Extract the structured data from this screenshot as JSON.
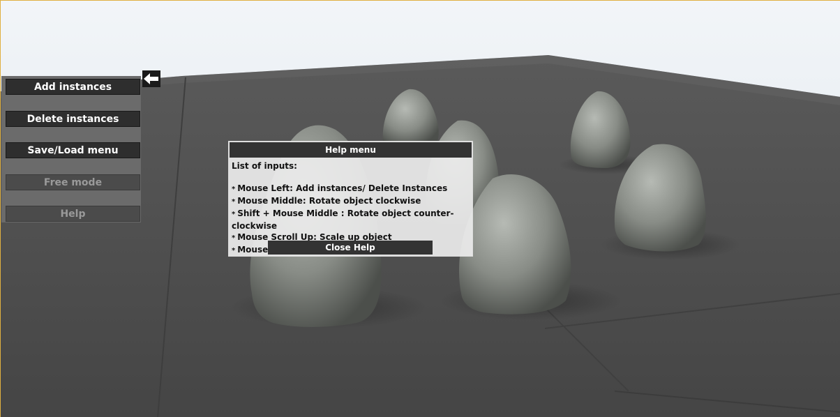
{
  "side_menu": {
    "buttons": [
      {
        "label": "Add instances",
        "enabled": true
      },
      {
        "label": "Delete instances",
        "enabled": true
      },
      {
        "label": "Save/Load menu",
        "enabled": true
      },
      {
        "label": "Free mode",
        "enabled": false
      },
      {
        "label": "Help",
        "enabled": false
      }
    ],
    "collapse_icon": "arrow-left-icon"
  },
  "help_dialog": {
    "title": "Help menu",
    "heading": "List of inputs:",
    "bullet": "*",
    "lines": [
      "Mouse Left: Add instances/ Delete Instances",
      "Mouse Middle: Rotate object clockwise",
      "Shift + Mouse Middle : Rotate object counter-clockwise",
      "Mouse Scroll Up: Scale up object",
      "Mouse Scroll Down: Scale down object"
    ],
    "close_label": "Close Help"
  },
  "scene": {
    "sky_color": "#e6ecf2",
    "ground_color": "#4d4d4d",
    "rock_color": "#8f948e"
  }
}
